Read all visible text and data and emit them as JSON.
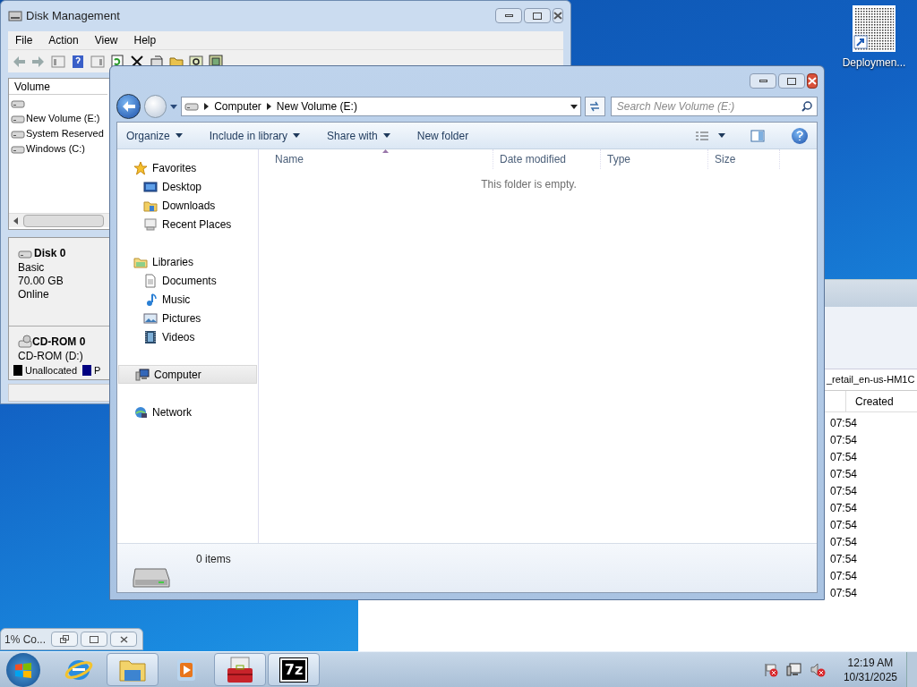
{
  "desktop_icons": [
    {
      "label": "Deploymen..."
    }
  ],
  "disk_management": {
    "title": "Disk Management",
    "menu": [
      "File",
      "Action",
      "View",
      "Help"
    ],
    "volume_column": "Volume",
    "volumes": [
      {
        "kind": "unnamed"
      },
      {
        "kind": "named",
        "name": "New Volume (E:)"
      },
      {
        "kind": "named",
        "name": "System Reserved"
      },
      {
        "kind": "named",
        "name": "Windows (C:)"
      }
    ],
    "disks": [
      {
        "kind": "disk",
        "name": "Disk 0",
        "lines": [
          "Basic",
          "70.00 GB",
          "Online"
        ]
      },
      {
        "kind": "cdrom",
        "name": "CD-ROM 0",
        "lines": [
          "CD-ROM (D:)"
        ]
      }
    ],
    "legend": [
      {
        "label": "Unallocated",
        "color": "#000000"
      },
      {
        "label": "P",
        "color": "#000080"
      }
    ]
  },
  "background_window": {
    "path": "_retail_en-us-HM1C",
    "column": "Created",
    "rows": [
      "07:54",
      "07:54",
      "07:54",
      "07:54",
      "07:54",
      "07:54",
      "07:54",
      "07:54",
      "07:54",
      "07:54",
      "07:54"
    ]
  },
  "explorer": {
    "breadcrumbs": [
      "Computer",
      "New Volume (E:)"
    ],
    "search": {
      "placeholder": "Search New Volume (E:)"
    },
    "toolbar": [
      {
        "label": "Organize",
        "dropdown": true
      },
      {
        "label": "Include in library",
        "dropdown": true
      },
      {
        "label": "Share with",
        "dropdown": true
      },
      {
        "label": "New folder",
        "dropdown": false
      }
    ],
    "nav": [
      {
        "label": "Favorites",
        "kind": "star",
        "selected": false,
        "children": [
          {
            "label": "Desktop",
            "kind": "desktop",
            "selected": false
          },
          {
            "label": "Downloads",
            "kind": "folder",
            "selected": false
          },
          {
            "label": "Recent Places",
            "kind": "recent",
            "selected": false
          }
        ]
      },
      {
        "label": "Libraries",
        "kind": "library",
        "selected": false,
        "children": [
          {
            "label": "Documents",
            "kind": "document",
            "selected": false
          },
          {
            "label": "Music",
            "kind": "music",
            "selected": false
          },
          {
            "label": "Pictures",
            "kind": "pictures",
            "selected": false
          },
          {
            "label": "Videos",
            "kind": "video",
            "selected": false
          }
        ]
      },
      {
        "label": "Computer",
        "kind": "computer",
        "selected": true
      },
      {
        "label": "Network",
        "kind": "network",
        "selected": false
      }
    ],
    "columns": [
      "Name",
      "Date modified",
      "Type",
      "Size"
    ],
    "empty_message": "This folder is empty.",
    "status": "0 items"
  },
  "thumbnail": {
    "title": "1% Co..."
  },
  "taskbar": {
    "buttons": [
      {
        "kind": "ie",
        "active": false
      },
      {
        "kind": "explorer",
        "active": true
      },
      {
        "kind": "media",
        "active": false
      },
      {
        "kind": "toolbox",
        "active": true
      },
      {
        "kind": "sevenzip",
        "active": true,
        "label": "7z"
      }
    ],
    "time": "12:19 AM",
    "date": "10/31/2025"
  }
}
